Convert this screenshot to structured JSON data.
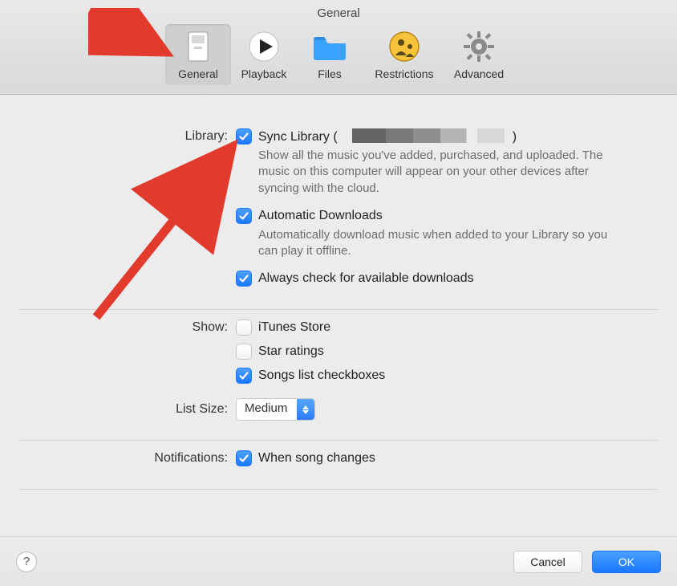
{
  "window_title": "General",
  "tabs": {
    "general": "General",
    "playback": "Playback",
    "files": "Files",
    "restrictions": "Restrictions",
    "advanced": "Advanced"
  },
  "labels": {
    "library": "Library:",
    "show": "Show:",
    "list_size": "List Size:",
    "notifications": "Notifications:"
  },
  "library": {
    "sync_label_prefix": "Sync Library (",
    "sync_label_suffix": ")",
    "sync_checked": true,
    "sync_desc": "Show all the music you've added, purchased, and uploaded. The music on this computer will appear on your other devices after syncing with the cloud.",
    "auto_label": "Automatic Downloads",
    "auto_checked": true,
    "auto_desc": "Automatically download music when added to your Library so you can play it offline.",
    "always_label": "Always check for available downloads",
    "always_checked": true
  },
  "show": {
    "itunes_label": "iTunes Store",
    "itunes_checked": false,
    "star_label": "Star ratings",
    "star_checked": false,
    "songs_label": "Songs list checkboxes",
    "songs_checked": true
  },
  "list_size": {
    "value": "Medium"
  },
  "notifications": {
    "song_label": "When song changes",
    "song_checked": true
  },
  "footer": {
    "cancel": "Cancel",
    "ok": "OK"
  },
  "help_glyph": "?"
}
